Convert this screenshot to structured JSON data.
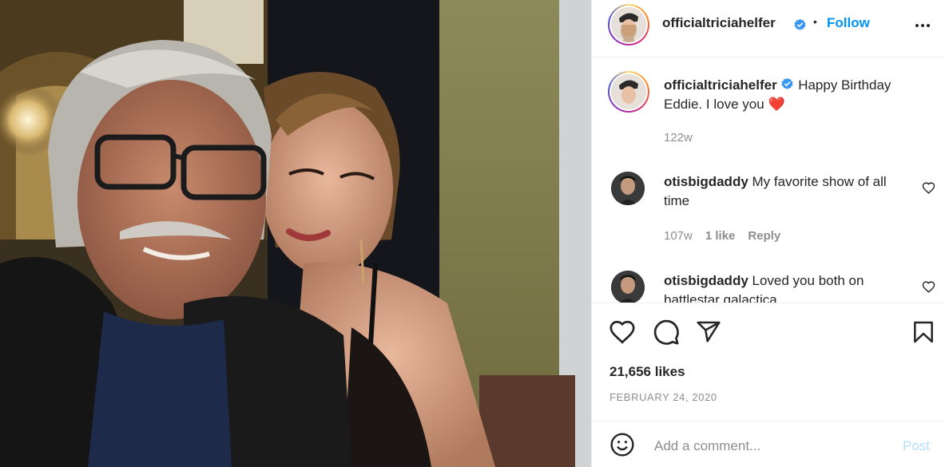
{
  "header": {
    "username": "officialtriciahelfer",
    "separator": "•",
    "follow_label": "Follow",
    "more_icon": "more-horizontal-icon",
    "verified_color": "#3897f0"
  },
  "caption": {
    "username": "officialtriciahelfer",
    "text": "Happy Birthday Eddie. I love you",
    "emoji": "❤️",
    "age": "122w"
  },
  "comments": [
    {
      "username": "otisbigdaddy",
      "text": "My favorite show of all time",
      "age": "107w",
      "likes": "1 like",
      "reply_label": "Reply"
    },
    {
      "username": "otisbigdaddy",
      "text": "Loved you both on battlestar galactica"
    }
  ],
  "actions": {
    "like_icon": "heart-icon",
    "comment_icon": "comment-icon",
    "share_icon": "share-icon",
    "save_icon": "bookmark-icon",
    "likes_count": "21,656 likes",
    "date": "FEBRUARY 24, 2020"
  },
  "add_comment": {
    "emoji_icon": "smiley-icon",
    "placeholder": "Add a comment...",
    "post_label": "Post"
  },
  "colors": {
    "accent": "#0095f6",
    "post_disabled": "#b2dffc",
    "muted": "#8e8e8e"
  }
}
